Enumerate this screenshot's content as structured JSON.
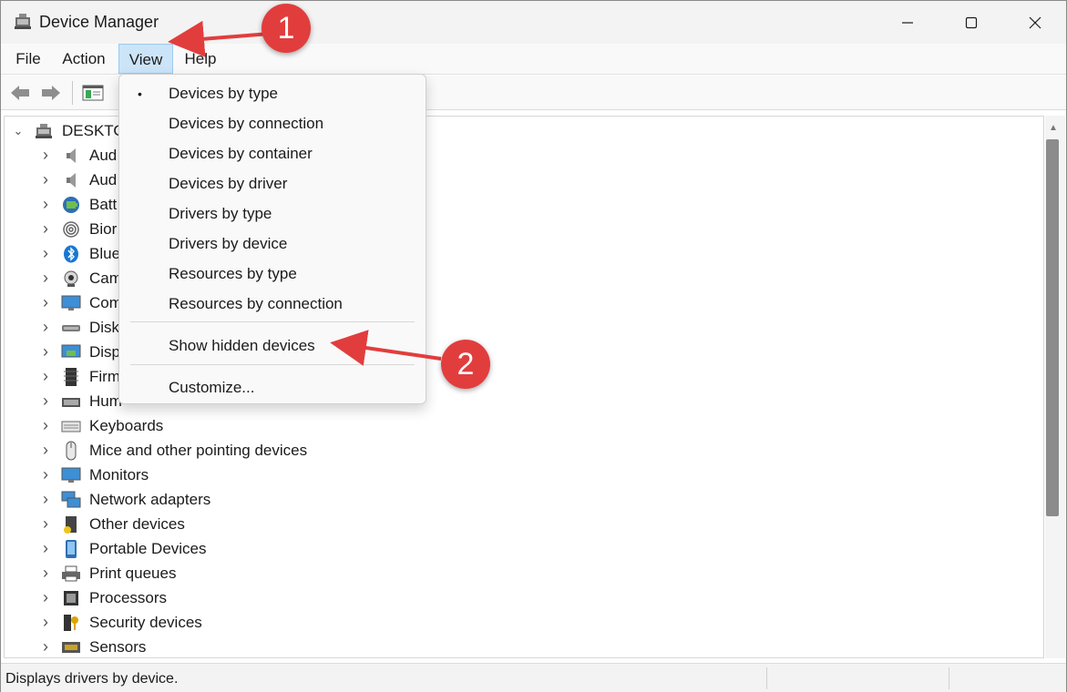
{
  "window": {
    "title": "Device Manager"
  },
  "menubar": {
    "items": [
      "File",
      "Action",
      "View",
      "Help"
    ]
  },
  "tree": {
    "root": "DESKTOP",
    "categories": [
      {
        "label": "Aud",
        "icon": "speaker-icon"
      },
      {
        "label": "Aud",
        "icon": "speaker-icon"
      },
      {
        "label": "Batt",
        "icon": "battery-icon"
      },
      {
        "label": "Bior",
        "icon": "fingerprint-icon"
      },
      {
        "label": "Blue",
        "icon": "bluetooth-icon"
      },
      {
        "label": "Cam",
        "icon": "camera-icon"
      },
      {
        "label": "Com",
        "icon": "computer-icon"
      },
      {
        "label": "Disk",
        "icon": "disk-drive-icon"
      },
      {
        "label": "Disp",
        "icon": "display-adapter-icon"
      },
      {
        "label": "Firm",
        "icon": "firmware-icon"
      },
      {
        "label": "Hum",
        "icon": "hid-icon"
      },
      {
        "label": "Keyboards",
        "icon": "keyboard-icon"
      },
      {
        "label": "Mice and other pointing devices",
        "icon": "mouse-icon"
      },
      {
        "label": "Monitors",
        "icon": "monitor-icon"
      },
      {
        "label": "Network adapters",
        "icon": "network-icon"
      },
      {
        "label": "Other devices",
        "icon": "unknown-device-icon"
      },
      {
        "label": "Portable Devices",
        "icon": "portable-device-icon"
      },
      {
        "label": "Print queues",
        "icon": "printer-icon"
      },
      {
        "label": "Processors",
        "icon": "processor-icon"
      },
      {
        "label": "Security devices",
        "icon": "security-key-icon"
      },
      {
        "label": "Sensors",
        "icon": "sensor-icon"
      }
    ]
  },
  "view_menu": {
    "items": [
      {
        "label": "Devices by type",
        "checked": true
      },
      {
        "label": "Devices by connection",
        "checked": false
      },
      {
        "label": "Devices by container",
        "checked": false
      },
      {
        "label": "Devices by driver",
        "checked": false
      },
      {
        "label": "Drivers by type",
        "checked": false
      },
      {
        "label": "Drivers by device",
        "checked": false
      },
      {
        "label": "Resources by type",
        "checked": false
      },
      {
        "label": "Resources by connection",
        "checked": false
      }
    ],
    "show_hidden": "Show hidden devices",
    "customize": "Customize...",
    "bullet": "•"
  },
  "statusbar": {
    "text": "Displays drivers by device."
  },
  "annotations": {
    "step1": "1",
    "step2": "2"
  },
  "colors": {
    "annotation": "#e23d3d",
    "menu_highlight": "#cce4f7"
  }
}
